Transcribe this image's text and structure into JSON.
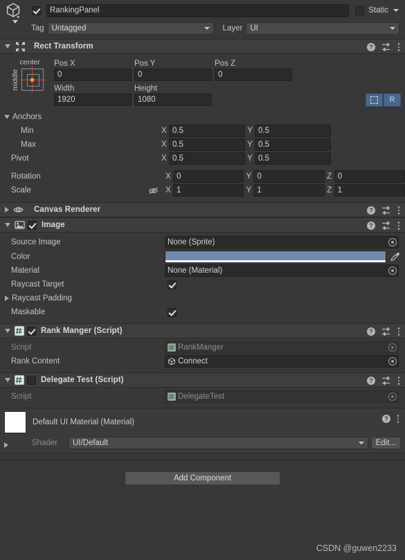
{
  "object_header": {
    "icon": "cube-icon",
    "enabled": true,
    "name": "RankingPanel",
    "static_checkbox": false,
    "static_label": "Static",
    "tag_label": "Tag",
    "tag_value": "Untagged",
    "layer_label": "Layer",
    "layer_value": "UI"
  },
  "rect_transform": {
    "title": "Rect Transform",
    "expanded": true,
    "icon": "rect-transform-icon",
    "anchor_preset": {
      "top_label": "center",
      "side_label": "middle"
    },
    "pos_labels": [
      "Pos X",
      "Pos Y",
      "Pos Z"
    ],
    "pos_values": [
      "0",
      "0",
      "0"
    ],
    "size_labels": [
      "Width",
      "Height"
    ],
    "size_values": [
      "1920",
      "1080"
    ],
    "blueprint_button": "blueprint-icon",
    "raw_button": "R",
    "anchors_label": "Anchors",
    "anchors": [
      {
        "label": "Min",
        "x": "0.5",
        "y": "0.5"
      },
      {
        "label": "Max",
        "x": "0.5",
        "y": "0.5"
      }
    ],
    "pivot": {
      "label": "Pivot",
      "x": "0.5",
      "y": "0.5"
    },
    "rotation": {
      "label": "Rotation",
      "x": "0",
      "y": "0",
      "z": "0"
    },
    "scale": {
      "label": "Scale",
      "x": "1",
      "y": "1",
      "z": "1",
      "icon": "eye-slash-icon"
    },
    "axis_x": "X",
    "axis_y": "Y",
    "axis_z": "Z"
  },
  "canvas_renderer": {
    "title": "Canvas Renderer",
    "expanded": false,
    "icon": "eye-icon"
  },
  "image": {
    "title": "Image",
    "expanded": true,
    "enabled": true,
    "icon": "image-icon",
    "properties": {
      "source_image_label": "Source Image",
      "source_image_value": "None (Sprite)",
      "color_label": "Color",
      "color_value": "#7189AD",
      "color_alpha": "#FFFFFF",
      "material_label": "Material",
      "material_value": "None (Material)",
      "raycast_target_label": "Raycast Target",
      "raycast_target_checked": true,
      "raycast_padding_label": "Raycast Padding",
      "maskable_label": "Maskable",
      "maskable_checked": true
    }
  },
  "rank_manager": {
    "title": "Rank Manger (Script)",
    "expanded": true,
    "enabled": true,
    "icon": "cs-script-icon",
    "script_label": "Script",
    "script_value": "RankManger",
    "rank_content_label": "Rank Content",
    "rank_content_value": "Connect"
  },
  "delegate_test": {
    "title": "Delegate Test (Script)",
    "expanded": true,
    "enabled": false,
    "icon": "cs-script-icon",
    "script_label": "Script",
    "script_value": "DelegateTest"
  },
  "material_preview": {
    "name": "Default UI Material (Material)",
    "shader_label": "Shader",
    "shader_value": "UI/Default",
    "edit_button": "Edit..."
  },
  "add_component_button": "Add Component",
  "watermark": "CSDN @guwen2233"
}
